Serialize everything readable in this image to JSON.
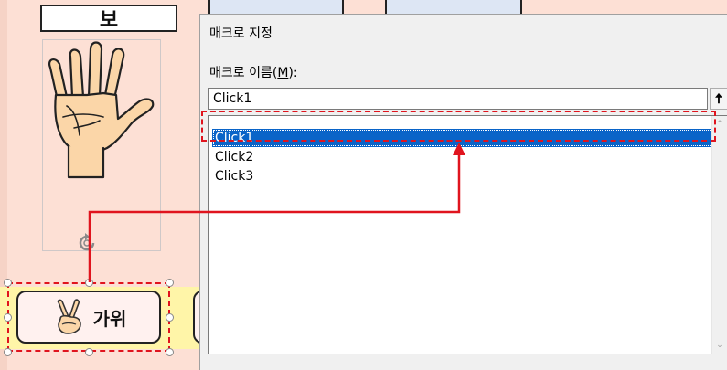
{
  "sheet": {
    "title_cell": "보",
    "scissors_button": {
      "label": "가위"
    }
  },
  "dialog": {
    "title": "매크로 지정",
    "name_label_prefix": "매크로 이름(",
    "name_label_mnemonic": "M",
    "name_label_suffix": "):",
    "name_value": "Click1",
    "up_button_glyph": "🠅",
    "macros": [
      {
        "name": "Click1",
        "selected": true
      },
      {
        "name": "Click2",
        "selected": false
      },
      {
        "name": "Click3",
        "selected": false
      }
    ]
  },
  "colors": {
    "sheet_background": "#fde0d5",
    "highlight_strip": "#fff5a8",
    "selection_blue": "#0a64c8",
    "annotation_red": "#e0141e"
  },
  "icons": {
    "hand_image": "open-hand-paper",
    "scissors_emoji": "victory-hand-icon",
    "rotate": "rotate-handle-icon"
  }
}
